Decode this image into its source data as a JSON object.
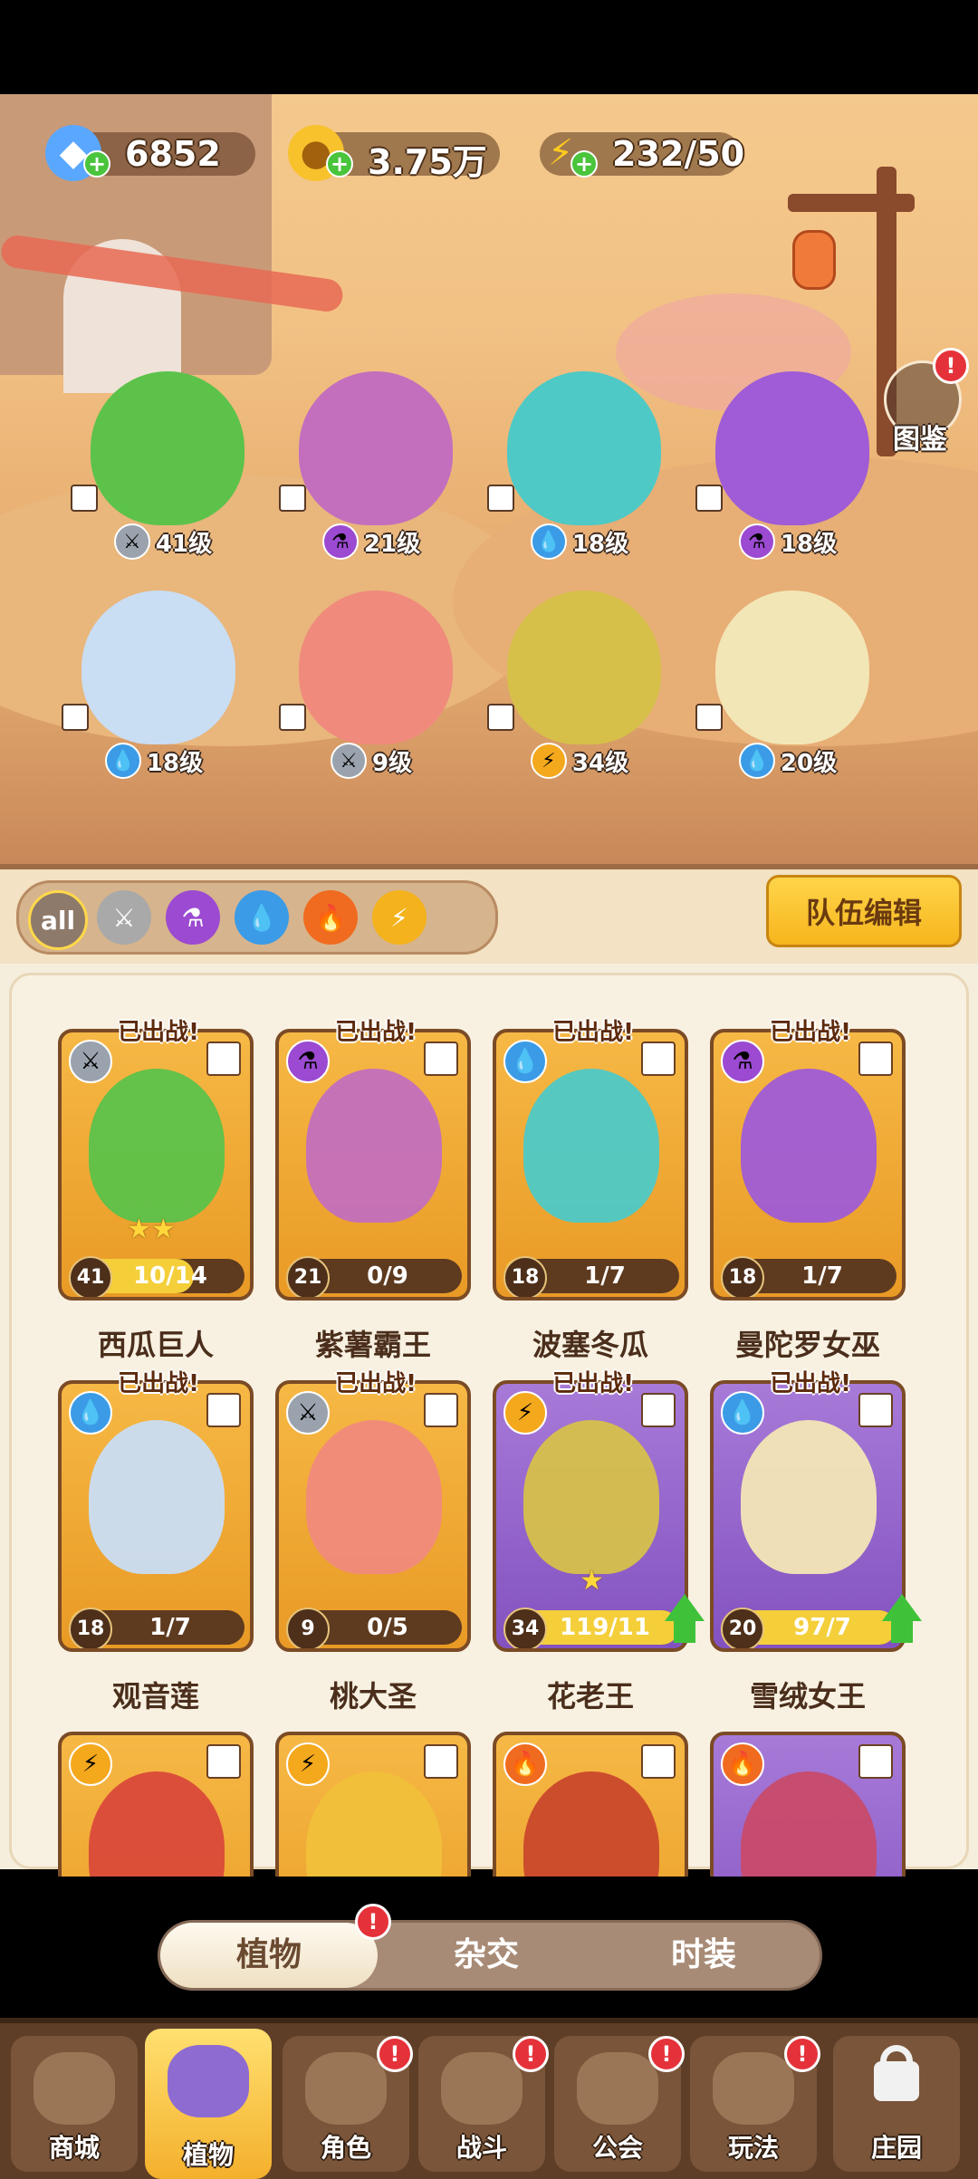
{
  "currencies": {
    "gems": {
      "value": "6852",
      "icon": "diamond-icon"
    },
    "coins": {
      "value": "3.75万",
      "icon": "coin-icon"
    },
    "energy": {
      "value": "232/50",
      "icon": "lightning-icon"
    }
  },
  "gallery": {
    "label": "图鉴"
  },
  "field_units": [
    {
      "level": "41级",
      "element": "sword"
    },
    {
      "level": "21级",
      "element": "potion"
    },
    {
      "level": "18级",
      "element": "water"
    },
    {
      "level": "18级",
      "element": "potion"
    },
    {
      "level": "18级",
      "element": "water"
    },
    {
      "level": "9级",
      "element": "sword"
    },
    {
      "level": "34级",
      "element": "lightning"
    },
    {
      "level": "20级",
      "element": "water"
    }
  ],
  "filters": {
    "all_label": "all",
    "items": [
      "sword-icon",
      "potion-icon",
      "water-icon",
      "fire-icon",
      "lightning-icon"
    ]
  },
  "team_edit_label": "队伍编辑",
  "deployed_label": "已出战!",
  "cards": [
    {
      "name": "西瓜巨人",
      "level": "41",
      "progress": "10/14",
      "fill": 0.71,
      "element": "sword"
    },
    {
      "name": "紫薯霸王",
      "level": "21",
      "progress": "0/9",
      "fill": 0.0,
      "element": "potion"
    },
    {
      "name": "波塞冬瓜",
      "level": "18",
      "progress": "1/7",
      "fill": 0.14,
      "element": "water"
    },
    {
      "name": "曼陀罗女巫",
      "level": "18",
      "progress": "1/7",
      "fill": 0.14,
      "element": "potion"
    },
    {
      "name": "观音莲",
      "level": "18",
      "progress": "1/7",
      "fill": 0.14,
      "element": "water"
    },
    {
      "name": "桃大圣",
      "level": "9",
      "progress": "0/5",
      "fill": 0.0,
      "element": "sword"
    },
    {
      "name": "花老王",
      "level": "34",
      "progress": "119/11",
      "fill": 1.0,
      "element": "lightning"
    },
    {
      "name": "雪绒女王",
      "level": "20",
      "progress": "97/7",
      "fill": 1.0,
      "element": "water"
    }
  ],
  "tabs": [
    "植物",
    "杂交",
    "时装"
  ],
  "nav": [
    "商城",
    "植物",
    "角色",
    "战斗",
    "公会",
    "玩法",
    "庄园"
  ],
  "colors": {
    "accent_gold": "#f6b51c",
    "purple_card": "#8352c0",
    "gold_card": "#e99a25",
    "upgrade_green": "#3fc23a",
    "badge_red": "#e5323a"
  }
}
